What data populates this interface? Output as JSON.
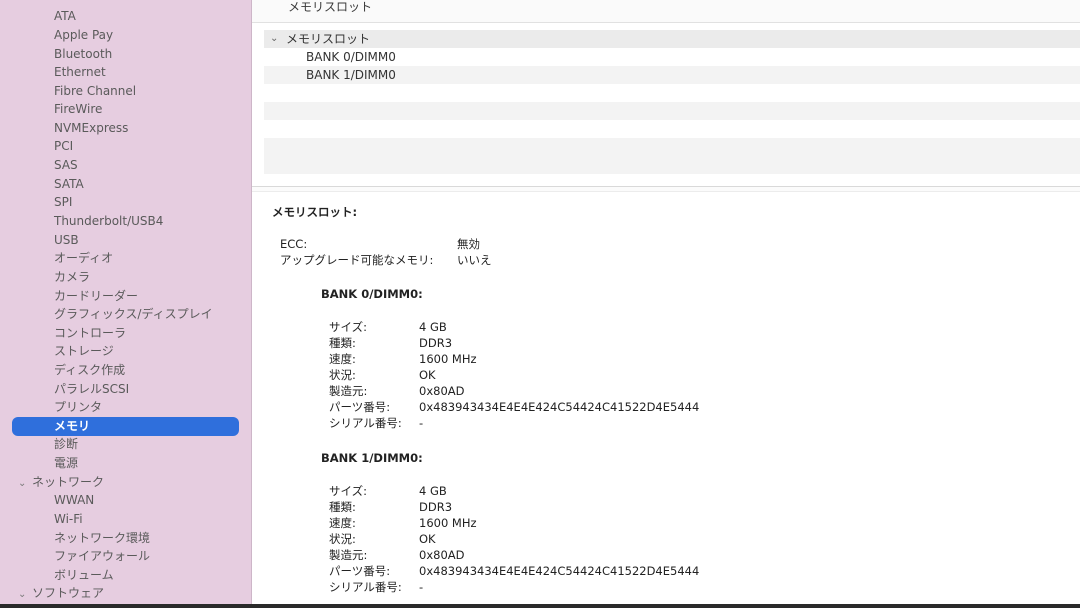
{
  "sidebar": {
    "items": [
      {
        "label": "ATA"
      },
      {
        "label": "Apple Pay"
      },
      {
        "label": "Bluetooth"
      },
      {
        "label": "Ethernet"
      },
      {
        "label": "Fibre Channel"
      },
      {
        "label": "FireWire"
      },
      {
        "label": "NVMExpress"
      },
      {
        "label": "PCI"
      },
      {
        "label": "SAS"
      },
      {
        "label": "SATA"
      },
      {
        "label": "SPI"
      },
      {
        "label": "Thunderbolt/USB4"
      },
      {
        "label": "USB"
      },
      {
        "label": "オーディオ"
      },
      {
        "label": "カメラ"
      },
      {
        "label": "カードリーダー"
      },
      {
        "label": "グラフィックス/ディスプレイ"
      },
      {
        "label": "コントローラ"
      },
      {
        "label": "ストレージ"
      },
      {
        "label": "ディスク作成"
      },
      {
        "label": "パラレルSCSI"
      },
      {
        "label": "プリンタ"
      },
      {
        "label": "メモリ"
      },
      {
        "label": "診断"
      },
      {
        "label": "電源"
      }
    ],
    "group_network": "ネットワーク",
    "network_items": [
      {
        "label": "WWAN"
      },
      {
        "label": "Wi-Fi"
      },
      {
        "label": "ネットワーク環境"
      },
      {
        "label": "ファイアウォール"
      },
      {
        "label": "ボリューム"
      }
    ],
    "group_software": "ソフトウェア",
    "selected": "メモリ"
  },
  "header": {
    "title": "メモリスロット"
  },
  "tree": {
    "root": "メモリスロット",
    "children": [
      "BANK 0/DIMM0",
      "BANK 1/DIMM0"
    ]
  },
  "detail": {
    "heading": "メモリスロット:",
    "ecc_label": "ECC:",
    "ecc_value": "無効",
    "upgrade_label": "アップグレード可能なメモリ:",
    "upgrade_value": "いいえ",
    "banks": [
      {
        "title": "BANK 0/DIMM0:",
        "rows": [
          {
            "label": "サイズ:",
            "value": "4 GB"
          },
          {
            "label": "種類:",
            "value": "DDR3"
          },
          {
            "label": "速度:",
            "value": "1600 MHz"
          },
          {
            "label": "状況:",
            "value": "OK"
          },
          {
            "label": "製造元:",
            "value": "0x80AD"
          },
          {
            "label": "パーツ番号:",
            "value": "0x483943434E4E4E424C54424C41522D4E5444"
          },
          {
            "label": "シリアル番号:",
            "value": "-"
          }
        ]
      },
      {
        "title": "BANK 1/DIMM0:",
        "rows": [
          {
            "label": "サイズ:",
            "value": "4 GB"
          },
          {
            "label": "種類:",
            "value": "DDR3"
          },
          {
            "label": "速度:",
            "value": "1600 MHz"
          },
          {
            "label": "状況:",
            "value": "OK"
          },
          {
            "label": "製造元:",
            "value": "0x80AD"
          },
          {
            "label": "パーツ番号:",
            "value": "0x483943434E4E4E424C54424C41522D4E5444"
          },
          {
            "label": "シリアル番号:",
            "value": "-"
          }
        ]
      }
    ]
  },
  "colors": {
    "selection": "#2f6fdc",
    "sidebar_bg": "#e6cde0"
  },
  "icons": {
    "disclosure": "chevron-down-icon"
  }
}
